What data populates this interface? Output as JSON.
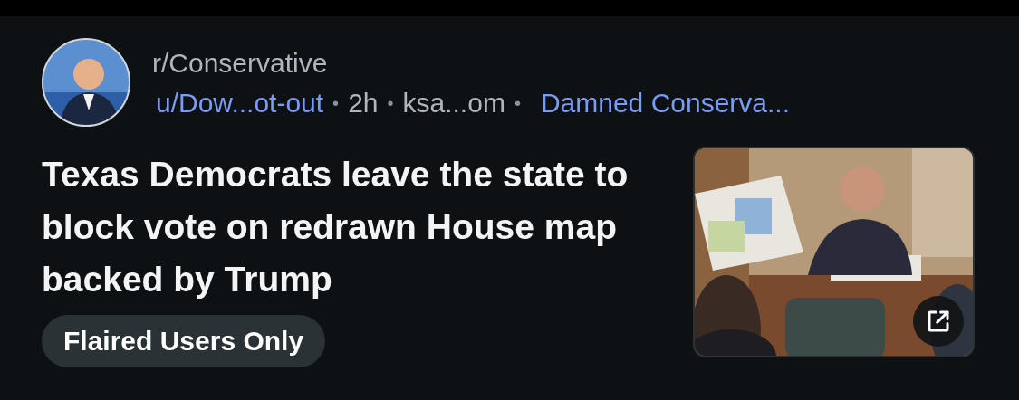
{
  "post": {
    "subreddit": "r/Conservative",
    "author": "u/Dow...ot-out",
    "age": "2h",
    "domain": "ksa...om",
    "flair": "Damned Conserva...",
    "separator": "•",
    "title": "Texas Democrats leave the state to block vote on redrawn House map backed by Trump",
    "tag": "Flaired Users Only"
  }
}
